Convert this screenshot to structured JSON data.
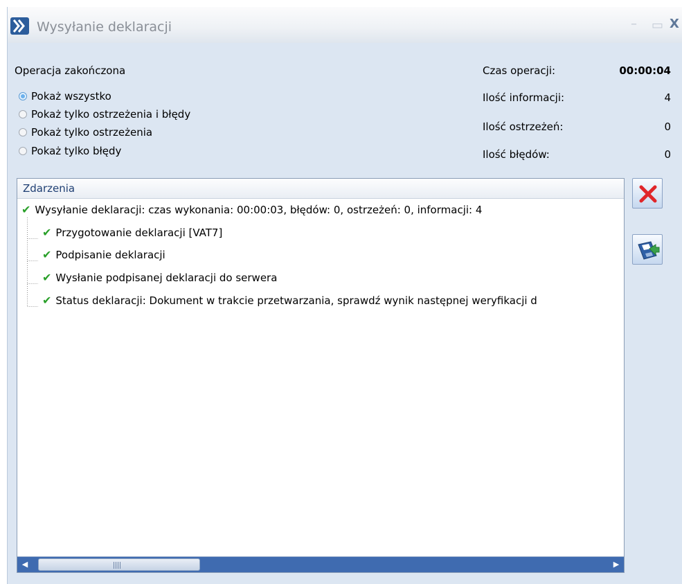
{
  "window": {
    "title": "Wysyłanie deklaracji",
    "controls": {
      "minimize": "–",
      "maximize": "▭",
      "close": "X"
    }
  },
  "status": "Operacja zakończona",
  "filters": {
    "options": [
      {
        "label": "Pokaż wszystko",
        "checked": true
      },
      {
        "label": "Pokaż tylko ostrzeżenia i błędy",
        "checked": false
      },
      {
        "label": "Pokaż tylko ostrzeżenia",
        "checked": false
      },
      {
        "label": "Pokaż tylko błędy",
        "checked": false
      }
    ]
  },
  "stats": {
    "time_label": "Czas operacji:",
    "time_value": "00:00:04",
    "info_label": "Ilość informacji:",
    "info_value": "4",
    "warn_label": "Ilość ostrzeżeń:",
    "warn_value": "0",
    "err_label": "Ilość błędów:",
    "err_value": "0"
  },
  "events": {
    "header": "Zdarzenia",
    "root": "Wysyłanie deklaracji: czas wykonania: 00:00:03, błędów: 0, ostrzeżeń: 0, informacji: 4",
    "children": [
      "Przygotowanie deklaracji [VAT7]",
      "Podpisanie deklaracji",
      "Wysłanie podpisanej deklaracji do serwera",
      "Status deklaracji: Dokument w trakcie przetwarzania, sprawdź wynik następnej weryfikacji d"
    ]
  },
  "colors": {
    "check": "#2aa02a",
    "accent": "#3f6bb0",
    "close_red": "#e0262a"
  },
  "icons": {
    "check": "✔",
    "scroll_left": "◀",
    "scroll_right": "▶"
  }
}
